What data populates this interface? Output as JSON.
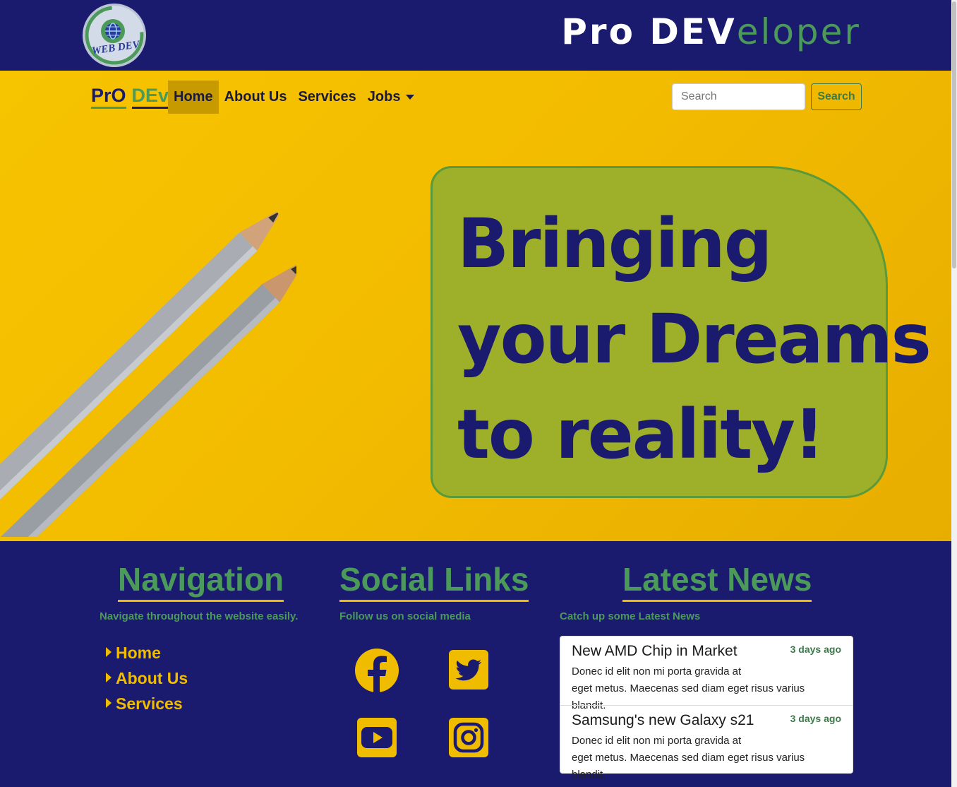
{
  "header": {
    "logo_text": "WEB DEV",
    "title_part1": "Pro DEV",
    "title_part2": "eloper"
  },
  "navbar": {
    "brand_part1": "PrO",
    "brand_part2": "DEv",
    "links": [
      "Home",
      "About Us",
      "Services",
      "Jobs"
    ],
    "active": "Home",
    "search_placeholder": "Search",
    "search_button": "Search"
  },
  "hero": {
    "lines": [
      "Bringing",
      "your Dreams",
      "to reality!"
    ]
  },
  "footer": {
    "navigation": {
      "title": "Navigation",
      "subtitle": "Navigate throughout the website easily.",
      "items": [
        "Home",
        "About Us",
        "Services"
      ]
    },
    "social": {
      "title": "Social Links",
      "subtitle": "Follow us on social media",
      "icons": [
        "facebook-icon",
        "twitter-icon",
        "youtube-icon",
        "instagram-icon"
      ]
    },
    "news": {
      "title": "Latest News",
      "subtitle": "Catch up some Latest News",
      "items": [
        {
          "title": "New AMD Chip in Market",
          "time": "3 days ago",
          "body_line1": "Donec id elit non mi porta gravida at",
          "body_line2": "eget metus. Maecenas sed diam eget risus varius blandit."
        },
        {
          "title": "Samsung's new Galaxy s21",
          "time": "3 days ago",
          "body_line1": "Donec id elit non mi porta gravida at",
          "body_line2": "eget metus. Maecenas sed diam eget risus varius blandit."
        }
      ]
    }
  },
  "colors": {
    "navy": "#1a1a6e",
    "yellow": "#f0bc00",
    "green": "#4c9a5a",
    "card": "#9eaf2a"
  }
}
